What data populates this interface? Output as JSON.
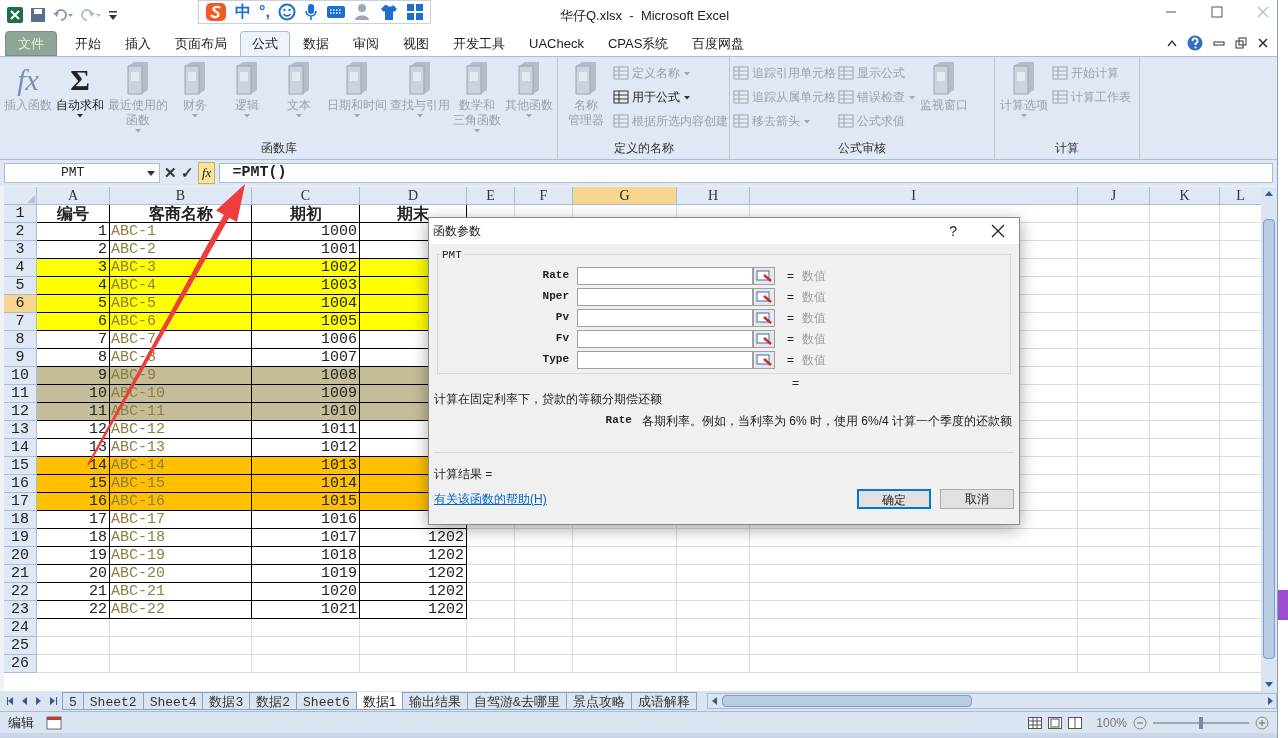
{
  "title_bar": {
    "title": "华仔Q.xlsx  -  Microsoft Excel",
    "ime_items": [
      "中",
      "°,"
    ]
  },
  "ribbon": {
    "tabs": [
      {
        "label": "文件",
        "selected": false,
        "kind": "file"
      },
      {
        "label": "开始",
        "selected": false,
        "kind": "tab"
      },
      {
        "label": "插入",
        "selected": false,
        "kind": "tab"
      },
      {
        "label": "页面布局",
        "selected": false,
        "kind": "tab"
      },
      {
        "label": "公式",
        "selected": true,
        "kind": "tab"
      },
      {
        "label": "数据",
        "selected": false,
        "kind": "tab"
      },
      {
        "label": "审阅",
        "selected": false,
        "kind": "tab"
      },
      {
        "label": "视图",
        "selected": false,
        "kind": "tab"
      },
      {
        "label": "开发工具",
        "selected": false,
        "kind": "tab"
      },
      {
        "label": "UACheck",
        "selected": false,
        "kind": "tab"
      },
      {
        "label": "CPAS系统",
        "selected": false,
        "kind": "tab"
      },
      {
        "label": "百度网盘",
        "selected": false,
        "kind": "tab"
      }
    ],
    "groups": [
      {
        "label": "函数库",
        "items": [
          {
            "kind": "large",
            "glyph": "fx",
            "lines": [
              "插入函数"
            ],
            "disabled": true,
            "dropdown": false
          },
          {
            "kind": "large",
            "glyph": "Σ",
            "lines": [
              "自动求和"
            ],
            "disabled": false,
            "dropdown": true
          },
          {
            "kind": "large",
            "lines": [
              "最近使用的",
              "函数"
            ],
            "disabled": true,
            "dropdown": true
          },
          {
            "kind": "large",
            "lines": [
              "财务"
            ],
            "disabled": true,
            "dropdown": true
          },
          {
            "kind": "large",
            "lines": [
              "逻辑"
            ],
            "disabled": true,
            "dropdown": true
          },
          {
            "kind": "large",
            "lines": [
              "文本"
            ],
            "disabled": true,
            "dropdown": true
          },
          {
            "kind": "large",
            "lines": [
              "日期和时间"
            ],
            "disabled": true,
            "dropdown": true
          },
          {
            "kind": "large",
            "lines": [
              "查找与引用"
            ],
            "disabled": true,
            "dropdown": true
          },
          {
            "kind": "large",
            "lines": [
              "数学和",
              "三角函数"
            ],
            "disabled": true,
            "dropdown": true
          },
          {
            "kind": "large",
            "lines": [
              "其他函数"
            ],
            "disabled": true,
            "dropdown": true
          }
        ]
      },
      {
        "label": "定义的名称",
        "items": [
          {
            "kind": "large",
            "lines": [
              "名称",
              "管理器"
            ],
            "disabled": true,
            "dropdown": false
          },
          {
            "kind": "small",
            "lines": [
              "定义名称"
            ],
            "disabled": true,
            "dropdown": true
          },
          {
            "kind": "small",
            "lines": [
              "用于公式"
            ],
            "disabled": false,
            "dropdown": true
          },
          {
            "kind": "small",
            "lines": [
              "根据所选内容创建"
            ],
            "disabled": true,
            "dropdown": false
          }
        ]
      },
      {
        "label": "公式审核",
        "items": [
          {
            "kind": "small",
            "lines": [
              "追踪引用单元格"
            ],
            "disabled": true,
            "dropdown": false
          },
          {
            "kind": "small",
            "lines": [
              "追踪从属单元格"
            ],
            "disabled": true,
            "dropdown": false
          },
          {
            "kind": "small",
            "lines": [
              "移去箭头"
            ],
            "disabled": true,
            "dropdown": true
          },
          {
            "kind": "small",
            "lines": [
              "显示公式"
            ],
            "disabled": true,
            "dropdown": false
          },
          {
            "kind": "small",
            "lines": [
              "错误检查"
            ],
            "disabled": true,
            "dropdown": true
          },
          {
            "kind": "small",
            "lines": [
              "公式求值"
            ],
            "disabled": true,
            "dropdown": false
          },
          {
            "kind": "large",
            "lines": [
              "监视窗口"
            ],
            "disabled": true,
            "dropdown": false
          }
        ]
      },
      {
        "label": "计算",
        "items": [
          {
            "kind": "large",
            "lines": [
              "计算选项"
            ],
            "disabled": true,
            "dropdown": true
          },
          {
            "kind": "small",
            "lines": [
              "开始计算"
            ],
            "disabled": true,
            "dropdown": false
          },
          {
            "kind": "small",
            "lines": [
              "计算工作表"
            ],
            "disabled": true,
            "dropdown": false
          }
        ]
      }
    ]
  },
  "formula_bar": {
    "name_box": "PMT",
    "cancel": "✕",
    "enter": "✓",
    "fx": "fx",
    "formula": "=PMT()"
  },
  "sheet": {
    "columns": [
      {
        "label": "A",
        "selected": false
      },
      {
        "label": "B",
        "selected": false
      },
      {
        "label": "C",
        "selected": false
      },
      {
        "label": "D",
        "selected": false
      },
      {
        "label": "E",
        "selected": false
      },
      {
        "label": "F",
        "selected": false
      },
      {
        "label": "G",
        "selected": true
      },
      {
        "label": "H",
        "selected": false
      },
      {
        "label": "I",
        "selected": false
      },
      {
        "label": "J",
        "selected": false
      },
      {
        "label": "K",
        "selected": false
      },
      {
        "label": "L",
        "selected": false
      }
    ],
    "rows": [
      {
        "label": "1",
        "selected": false,
        "kind": "header",
        "cells": [
          "编号",
          "客商名称",
          "期初",
          "期末"
        ]
      },
      {
        "label": "2",
        "selected": false,
        "kind": "data",
        "cells": [
          "1",
          "ABC-1",
          "1000"
        ]
      },
      {
        "label": "3",
        "selected": false,
        "kind": "data",
        "cells": [
          "2",
          "ABC-2",
          "1001"
        ]
      },
      {
        "label": "4",
        "selected": false,
        "kind": "data",
        "color": "#ffff00",
        "cells": [
          "3",
          "ABC-3",
          "1002"
        ]
      },
      {
        "label": "5",
        "selected": false,
        "kind": "data",
        "color": "#ffff00",
        "cells": [
          "4",
          "ABC-4",
          "1003"
        ]
      },
      {
        "label": "6",
        "selected": true,
        "kind": "data",
        "color": "#ffff00",
        "cells": [
          "5",
          "ABC-5",
          "1004"
        ]
      },
      {
        "label": "7",
        "selected": false,
        "kind": "data",
        "color": "#ffff00",
        "cells": [
          "6",
          "ABC-6",
          "1005"
        ]
      },
      {
        "label": "8",
        "selected": false,
        "kind": "data",
        "cells": [
          "7",
          "ABC-7",
          "1006"
        ]
      },
      {
        "label": "9",
        "selected": false,
        "kind": "data",
        "cells": [
          "8",
          "ABC-8",
          "1007"
        ]
      },
      {
        "label": "10",
        "selected": false,
        "kind": "data",
        "color": "#c4bd97",
        "cells": [
          "9",
          "ABC-9",
          "1008"
        ]
      },
      {
        "label": "11",
        "selected": false,
        "kind": "data",
        "color": "#c4bd97",
        "cells": [
          "10",
          "ABC-10",
          "1009"
        ]
      },
      {
        "label": "12",
        "selected": false,
        "kind": "data",
        "color": "#c4bd97",
        "cells": [
          "11",
          "ABC-11",
          "1010"
        ]
      },
      {
        "label": "13",
        "selected": false,
        "kind": "data",
        "cells": [
          "12",
          "ABC-12",
          "1011"
        ]
      },
      {
        "label": "14",
        "selected": false,
        "kind": "data",
        "cells": [
          "13",
          "ABC-13",
          "1012"
        ]
      },
      {
        "label": "15",
        "selected": false,
        "kind": "data",
        "color": "#ffc000",
        "cells": [
          "14",
          "ABC-14",
          "1013"
        ]
      },
      {
        "label": "16",
        "selected": false,
        "kind": "data",
        "color": "#ffc000",
        "cells": [
          "15",
          "ABC-15",
          "1014"
        ]
      },
      {
        "label": "17",
        "selected": false,
        "kind": "data",
        "color": "#ffc000",
        "cells": [
          "16",
          "ABC-16",
          "1015"
        ]
      },
      {
        "label": "18",
        "selected": false,
        "kind": "data",
        "cells": [
          "17",
          "ABC-17",
          "1016"
        ]
      },
      {
        "label": "19",
        "selected": false,
        "kind": "data",
        "cells": [
          "18",
          "ABC-18",
          "1017",
          "1202"
        ]
      },
      {
        "label": "20",
        "selected": false,
        "kind": "data",
        "cells": [
          "19",
          "ABC-19",
          "1018",
          "1202"
        ]
      },
      {
        "label": "21",
        "selected": false,
        "kind": "data",
        "cells": [
          "20",
          "ABC-20",
          "1019",
          "1202"
        ]
      },
      {
        "label": "22",
        "selected": false,
        "kind": "data",
        "cells": [
          "21",
          "ABC-21",
          "1020",
          "1202"
        ]
      },
      {
        "label": "23",
        "selected": false,
        "kind": "data",
        "cells": [
          "22",
          "ABC-22",
          "1021",
          "1202"
        ]
      },
      {
        "label": "24",
        "selected": false,
        "kind": "empty"
      },
      {
        "label": "25",
        "selected": false,
        "kind": "empty"
      },
      {
        "label": "26",
        "selected": false,
        "kind": "empty"
      }
    ]
  },
  "dialog": {
    "title": "函数参数",
    "help": "?",
    "function": "PMT",
    "params": [
      {
        "name": "Rate",
        "equals": "=",
        "value": "数值"
      },
      {
        "name": "Nper",
        "equals": "=",
        "value": "数值"
      },
      {
        "name": "Pv",
        "equals": "=",
        "value": "数值"
      },
      {
        "name": "Fv",
        "equals": "=",
        "value": "数值"
      },
      {
        "name": "Type",
        "equals": "=",
        "value": "数值"
      }
    ],
    "total_equals": "=",
    "description": "计算在固定利率下，贷款的等额分期偿还额",
    "arg_name": "Rate",
    "arg_help": "各期利率。例如，当利率为 6% 时，使用 6%/4 计算一个季度的还款额",
    "result": "计算结果 =",
    "help_link": "有关该函数的帮助(H)",
    "buttons": [
      {
        "label": "确定",
        "selected": true
      },
      {
        "label": "取消",
        "selected": false
      }
    ]
  },
  "sheet_tabs": [
    {
      "label": "5",
      "selected": false
    },
    {
      "label": "Sheet2",
      "selected": false
    },
    {
      "label": "Sheet4",
      "selected": false
    },
    {
      "label": "数据3",
      "selected": false
    },
    {
      "label": "数据2",
      "selected": false
    },
    {
      "label": "Sheet6",
      "selected": false
    },
    {
      "label": "数据1",
      "selected": true
    },
    {
      "label": "输出结果",
      "selected": false
    },
    {
      "label": "自驾游&去哪里",
      "selected": false
    },
    {
      "label": "景点攻略",
      "selected": false
    },
    {
      "label": "成语解释",
      "selected": false
    }
  ],
  "status_bar": {
    "mode": "编辑",
    "zoom": "100%",
    "zoom_slider": {
      "level": 0.5
    }
  }
}
